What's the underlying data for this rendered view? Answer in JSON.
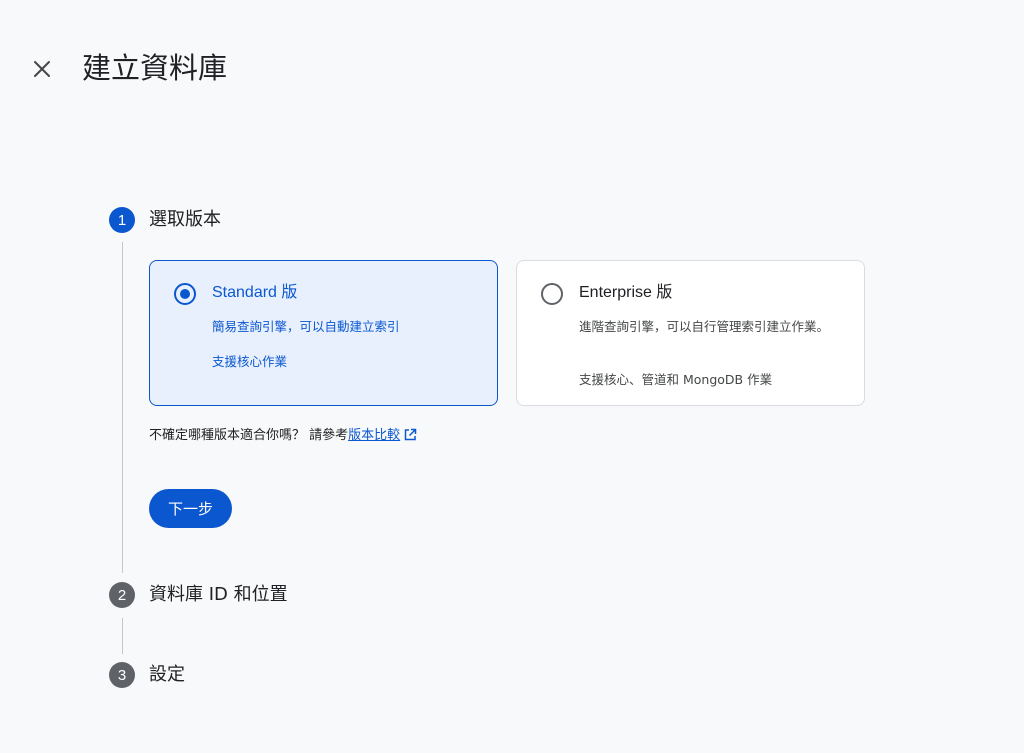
{
  "header": {
    "title": "建立資料庫",
    "close_icon": "close-icon"
  },
  "steps": [
    {
      "number": "1",
      "label": "選取版本",
      "state": "active"
    },
    {
      "number": "2",
      "label": "資料庫 ID 和位置",
      "state": "inactive"
    },
    {
      "number": "3",
      "label": "設定",
      "state": "inactive"
    }
  ],
  "editions": [
    {
      "title": "Standard 版",
      "description": "簡易查詢引擎，可以自動建立索引",
      "feature": "支援核心作業",
      "selected": true
    },
    {
      "title": "Enterprise 版",
      "description": "進階查詢引擎，可以自行管理索引建立作業。",
      "feature": "支援核心、管道和 MongoDB 作業",
      "selected": false
    }
  ],
  "hint": {
    "text": "不確定哪種版本適合你嗎？ 請參考",
    "link_label": "版本比較",
    "link_icon": "open-in-new-icon"
  },
  "next_button": {
    "label": "下一步"
  },
  "colors": {
    "accent": "#0b57d0",
    "selected_bg": "#e8f0fe",
    "inactive_step": "#5f6368",
    "page_bg": "#f8f9fa"
  }
}
